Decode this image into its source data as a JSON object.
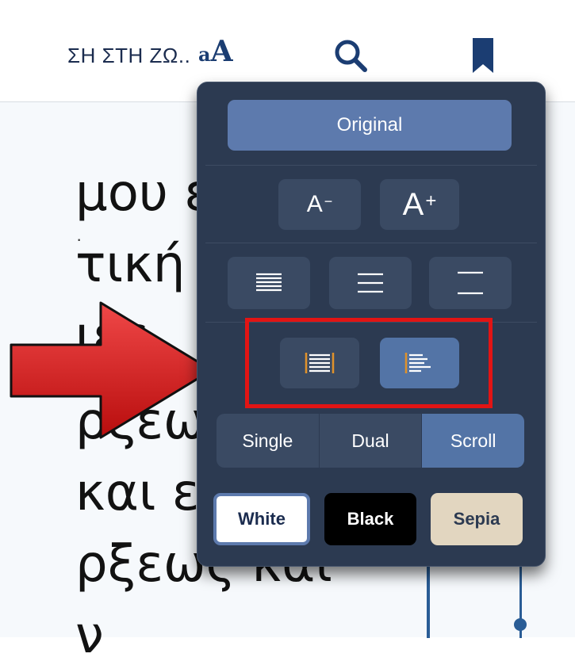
{
  "toolbar": {
    "book_title": "ΣΗ ΣΤΗ ΖΩ..",
    "font_icon_small": "a",
    "font_icon_big": "A",
    "icons": [
      "font-size-icon",
      "search-icon",
      "bookmark-icon"
    ]
  },
  "page": {
    "mark": "·",
    "lines": [
      "μου είν",
      "τική ει",
      "ιες",
      "ρξεω",
      " και ει",
      "ρξεως και",
      "ν"
    ]
  },
  "panel": {
    "original_label": "Original",
    "font_decrease": {
      "letter": "A",
      "sign": "−"
    },
    "font_increase": {
      "letter": "A",
      "sign": "+"
    },
    "spacing_icons": [
      "line-spacing-tight-icon",
      "line-spacing-medium-icon",
      "line-spacing-wide-icon"
    ],
    "alignment_icons": [
      "justify-align-icon",
      "left-align-icon"
    ],
    "layout_modes": [
      {
        "label": "Single",
        "active": false
      },
      {
        "label": "Dual",
        "active": false
      },
      {
        "label": "Scroll",
        "active": true
      }
    ],
    "themes": [
      {
        "label": "White",
        "selected": true
      },
      {
        "label": "Black",
        "selected": false
      },
      {
        "label": "Sepia",
        "selected": false
      }
    ]
  },
  "colors": {
    "panel_bg": "#2c3a51",
    "accent": "#5374a6",
    "highlight": "#e21414",
    "toolbar_icon": "#1b3d72"
  }
}
